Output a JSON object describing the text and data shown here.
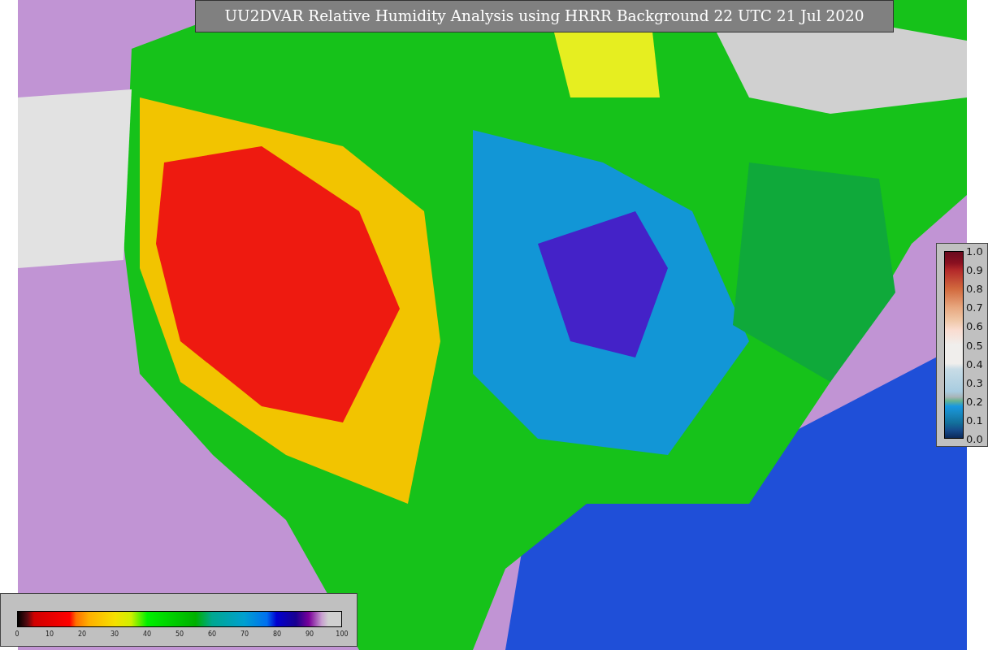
{
  "title": "UU2DVAR Relative Humidity Analysis using HRRR Background 22 UTC 21 Jul 2020",
  "horizontal_colorbar": {
    "ticks": [
      "0",
      "10",
      "20",
      "30",
      "40",
      "50",
      "60",
      "70",
      "80",
      "90",
      "100"
    ]
  },
  "vertical_colorbar": {
    "ticks": [
      "1.0",
      "0.9",
      "0.8",
      "0.7",
      "0.6",
      "0.5",
      "0.4",
      "0.3",
      "0.2",
      "0.1",
      "0.0"
    ]
  }
}
